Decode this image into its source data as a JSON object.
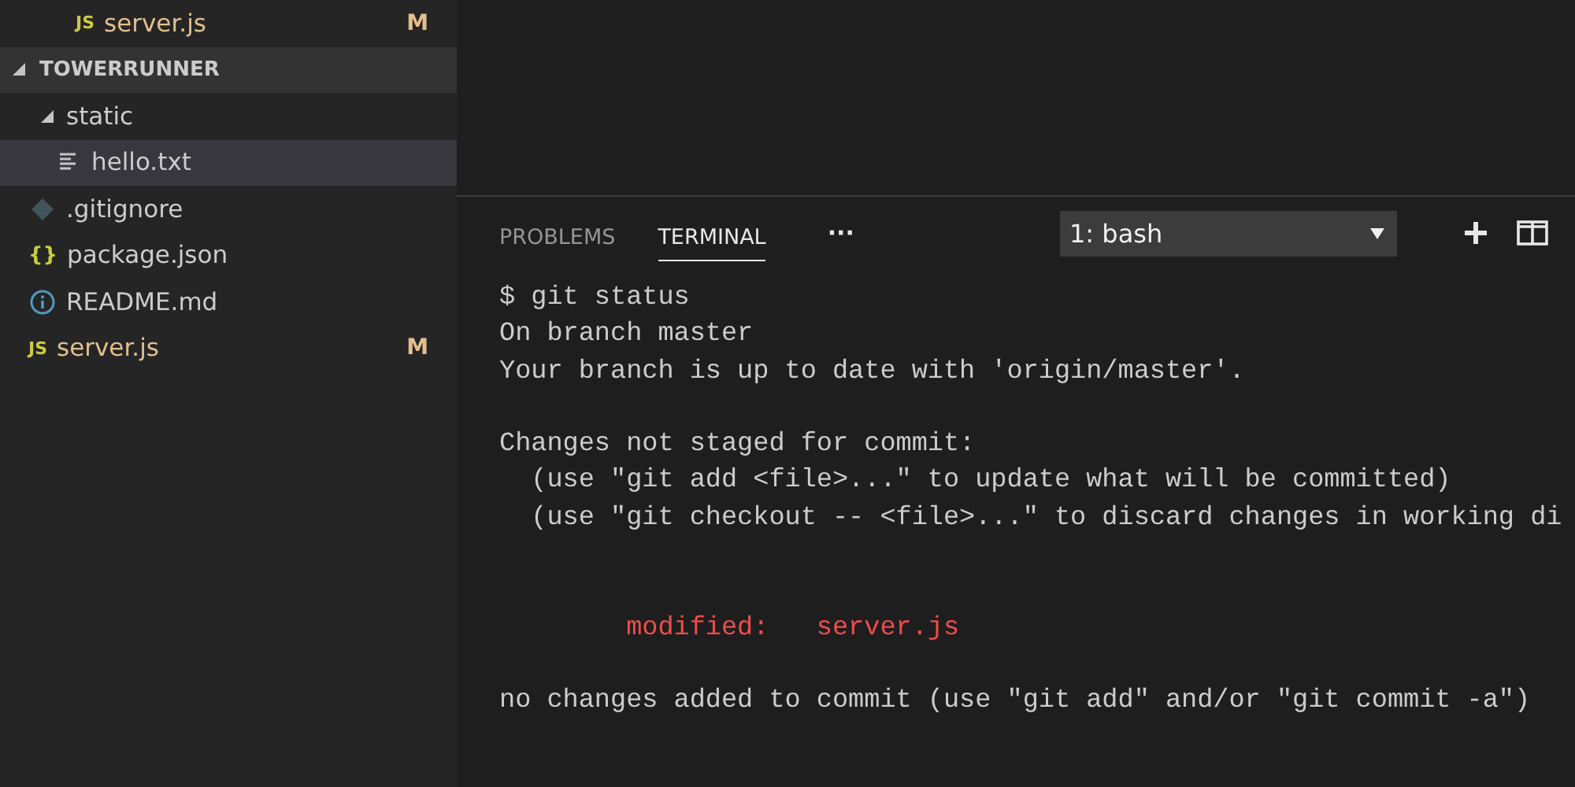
{
  "sidebar": {
    "partial_section": {
      "items": [
        {
          "label": "server.js",
          "kind": "js",
          "icon": "JS",
          "status": "M",
          "selected": false
        }
      ]
    },
    "section": {
      "title": "TOWERRUNNER",
      "expanded": true,
      "items": [
        {
          "label": "static",
          "kind": "folder",
          "expanded": true,
          "selected": false,
          "children": [
            {
              "label": "hello.txt",
              "kind": "text",
              "selected": true
            }
          ]
        },
        {
          "label": ".gitignore",
          "kind": "git",
          "selected": false
        },
        {
          "label": "package.json",
          "kind": "json",
          "icon": "{}",
          "selected": false
        },
        {
          "label": "README.md",
          "kind": "info",
          "selected": false
        },
        {
          "label": "server.js",
          "kind": "js",
          "icon": "JS",
          "status": "M",
          "selected": false
        }
      ]
    }
  },
  "panel": {
    "tabs": [
      {
        "label": "PROBLEMS",
        "selected": false
      },
      {
        "label": "TERMINAL",
        "selected": true
      }
    ],
    "more": "···",
    "terminal_select": {
      "value": "1: bash"
    },
    "terminal": {
      "lines": [
        {
          "kind": "text",
          "text": "$ git status"
        },
        {
          "kind": "text",
          "text": "On branch master"
        },
        {
          "kind": "text",
          "text": "Your branch is up to date with 'origin/master'."
        },
        {
          "kind": "blank"
        },
        {
          "kind": "text",
          "text": "Changes not staged for commit:"
        },
        {
          "kind": "text",
          "text": "  (use \"git add <file>...\" to update what will be committed)"
        },
        {
          "kind": "text",
          "text": "  (use \"git checkout -- <file>...\" to discard changes in working di"
        },
        {
          "kind": "blank"
        },
        {
          "kind": "blank"
        },
        {
          "kind": "change",
          "text": "        modified:   server.js"
        },
        {
          "kind": "blank"
        },
        {
          "kind": "text",
          "text": "no changes added to commit (use \"git add\" and/or \"git commit -a\")"
        }
      ]
    }
  }
}
